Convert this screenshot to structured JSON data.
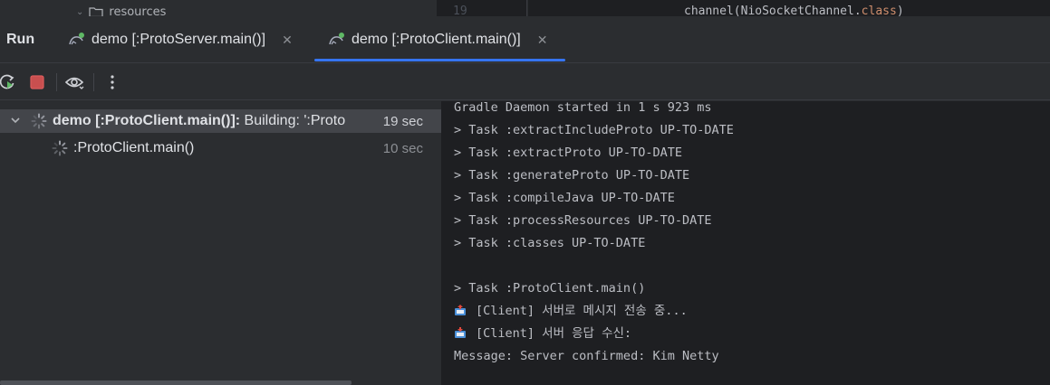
{
  "peek": {
    "folder_label": "resources",
    "line_number": "19",
    "code_prefix": "channel(NioSocketChannel.",
    "code_keyword": "class",
    "code_suffix": ")"
  },
  "run_panel": {
    "title": "Run",
    "tabs": [
      {
        "label": "demo [:ProtoServer.main()]",
        "active": false
      },
      {
        "label": "demo [:ProtoClient.main()]",
        "active": true
      }
    ]
  },
  "toolbar": {
    "icons": [
      "rerun-icon",
      "stop-icon",
      "eye-icon",
      "more-icon"
    ]
  },
  "tree": {
    "items": [
      {
        "label_bold": "demo [:ProtoClient.main()]:",
        "label_rest": " Building: ':Proto",
        "time": "19 sec"
      },
      {
        "label": ":ProtoClient.main()",
        "time": "10 sec"
      }
    ]
  },
  "console": {
    "lines": [
      "Gradle Daemon started in 1 s 923 ms",
      "> Task :extractIncludeProto UP-TO-DATE",
      "> Task :extractProto UP-TO-DATE",
      "> Task :generateProto UP-TO-DATE",
      "> Task :compileJava UP-TO-DATE",
      "> Task :processResources UP-TO-DATE",
      "> Task :classes UP-TO-DATE",
      "",
      "> Task :ProtoClient.main()",
      "[Client] 서버로 메시지 전송 중...",
      "[Client] 서버 응답 수신:",
      "Message: Server confirmed: Kim Netty"
    ]
  },
  "colors": {
    "accent": "#3574f0",
    "stop": "#db5c5c",
    "running": "#5fb865"
  }
}
